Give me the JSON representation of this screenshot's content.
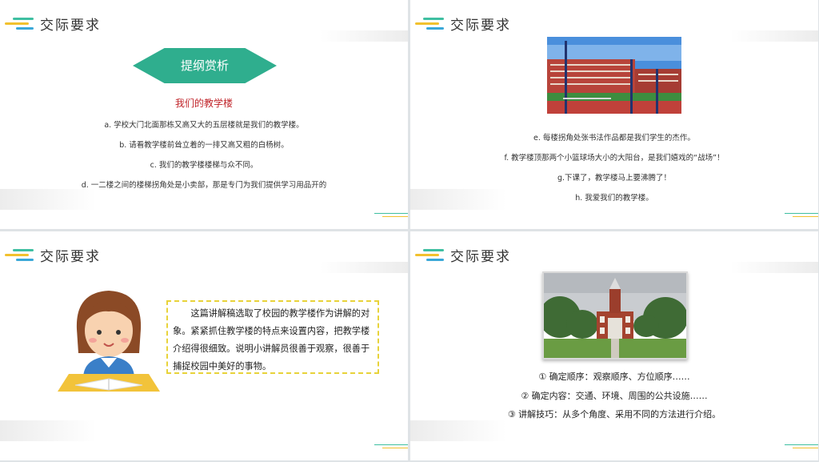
{
  "slides": [
    {
      "title": "交际要求",
      "banner": "提纲赏析",
      "subtitle": "我们的教学楼",
      "lines": [
        "a. 学校大门北面那栋又高又大的五层楼就是我们的教学楼。",
        "b. 请看教学楼前耸立着的一排又高又粗的白杨树。",
        "c. 我们的教学楼楼梯与众不同。",
        "d. 一二楼之间的楼梯拐角处是小卖部，那是专门为我们提供学习用品开的"
      ]
    },
    {
      "title": "交际要求",
      "lines": [
        "e. 每楼拐角处张书法作品都是我们学生的杰作。",
        "f. 教学楼顶那两个小篮球场大小的大阳台，是我们嬉戏的“战场”！",
        "g.下课了，教学楼马上要沸腾了！",
        "h. 我爱我们的教学楼。"
      ]
    },
    {
      "title": "交际要求",
      "paragraph": "　　这篇讲解稿选取了校园的教学楼作为讲解的对象。紧紧抓住教学楼的特点来设置内容，把教学楼介绍得很细致。说明小讲解员很善于观察，很善于捕捉校园中美好的事物。"
    },
    {
      "title": "交际要求",
      "items": [
        "①  确定顺序：观察顺序、方位顺序……",
        "②  确定内容：交通、环境、周围的公共设施……",
        "③  讲解技巧：从多个角度、采用不同的方法进行介绍。"
      ]
    }
  ],
  "colors": {
    "accent_green": "#2fae8e",
    "subtitle_red": "#c0242a",
    "dash_yellow": "#e8d33a"
  }
}
